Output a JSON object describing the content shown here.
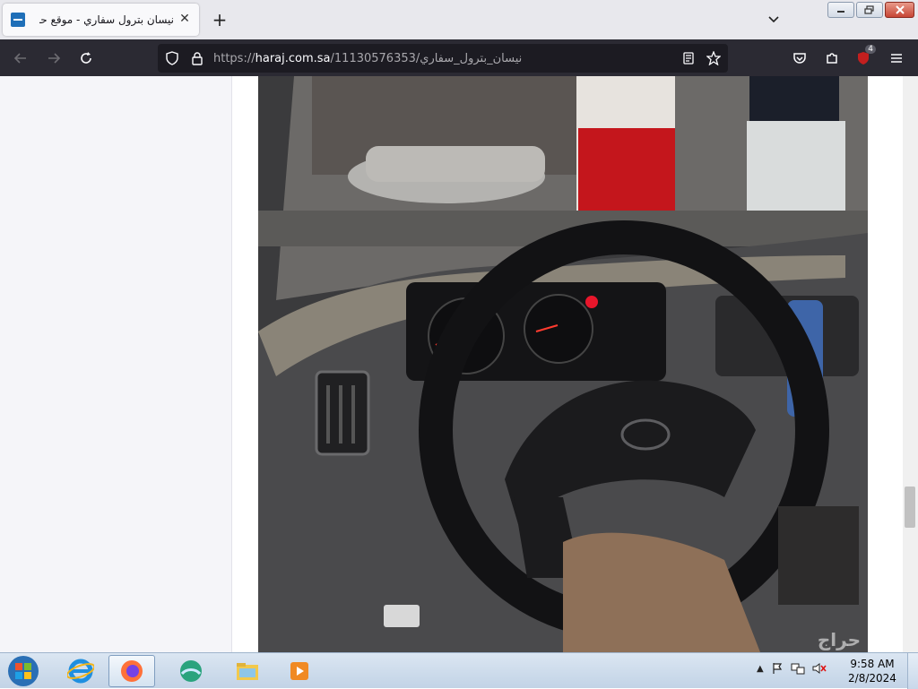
{
  "browser": {
    "tab_title": "نيسان بترول سفاري - موقع حراج",
    "new_tab_label": "+",
    "url_prefix": "https://",
    "url_host": "haraj.com.sa",
    "url_path": "/11130576353/نيسان_بترول_سفاري",
    "extensions_badge": "4"
  },
  "page": {
    "photo_alt": "نيسان بترول سفاري",
    "watermark": "حراج"
  },
  "taskbar": {
    "time": "9:58 AM",
    "date": "2/8/2024"
  },
  "colors": {
    "tab_bar": "#e8e8ed",
    "nav_bar": "#2b2a33",
    "url_bar": "#1c1b22",
    "taskbar": "#c8d8ea"
  }
}
